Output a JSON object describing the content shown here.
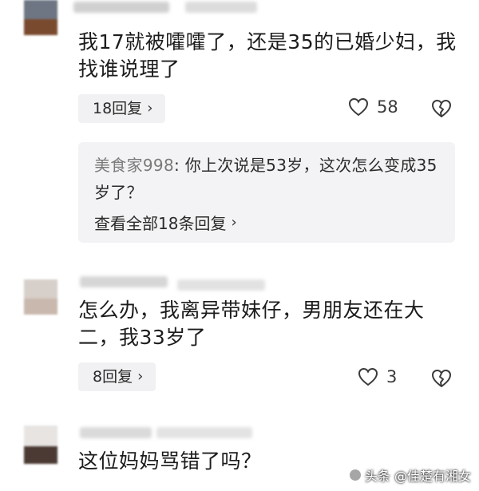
{
  "comments": [
    {
      "text": "我17就被嚯嚯了，还是35的已婚少妇，我找谁说理了",
      "replies_label": "18回复",
      "likes": "58"
    },
    {
      "text": "怎么办，我离异带妹仔，男朋友还在大二，我33岁了",
      "replies_label": "8回复",
      "likes": "3"
    },
    {
      "text": "这位妈妈骂错了吗？"
    }
  ],
  "sub_reply": {
    "author": "美食家998",
    "text": "你上次说是53岁，这次怎么变成35岁了？",
    "view_all": "查看全部18条回复"
  },
  "watermark": {
    "text": "头条 @佳楚有湘女"
  },
  "colors": {
    "pill_bg": "#f1f1f3",
    "sub_bg": "#f3f3f5",
    "author": "#7a7a7a"
  },
  "icons": {
    "chevron": "chevron-right-icon",
    "like": "heart-icon",
    "dislike": "broken-heart-icon"
  }
}
